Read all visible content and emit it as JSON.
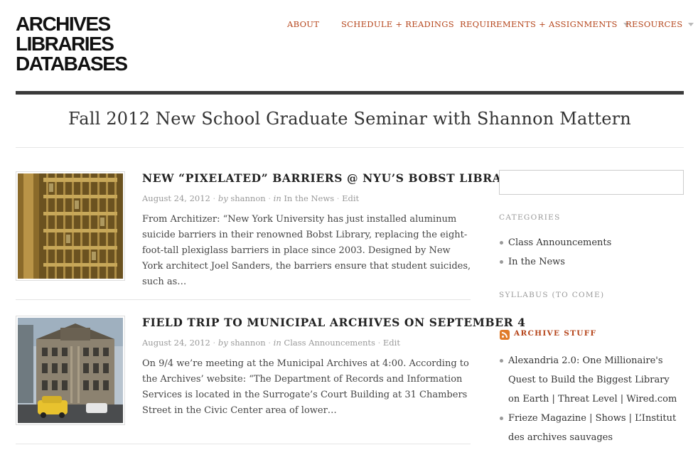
{
  "site": {
    "logo_lines": [
      "ARCHIVES",
      "LIBRARIES",
      "DATABASES"
    ],
    "tagline": "Fall 2012 New School Graduate Seminar with Shannon Mattern"
  },
  "nav": {
    "items": [
      {
        "label": "ABOUT",
        "has_dropdown": false
      },
      {
        "label": "SCHEDULE + READINGS",
        "has_dropdown": false
      },
      {
        "label": "REQUIREMENTS + ASSIGNMENTS",
        "has_dropdown": true
      },
      {
        "label": "RESOURCES",
        "has_dropdown": true
      }
    ]
  },
  "posts": [
    {
      "title": "NEW “PIXELATED” BARRIERS @ NYU’S BOBST LIBRARY",
      "date": "August 24, 2012",
      "by": "by",
      "author": "shannon",
      "in": "in",
      "category": "In the News",
      "edit": "Edit",
      "excerpt": "From Architizer: “New York University has just installed aluminum suicide barriers in their renowned Bobst Library, replacing the eight-foot-tall plexiglass barriers in place since 2003. Designed by New York architect Joel Sanders, the barriers ensure that student suicides, such as…",
      "thumb_icon": "library-barrier-photo"
    },
    {
      "title": "FIELD TRIP TO MUNICIPAL ARCHIVES ON SEPTEMBER 4",
      "date": "August 24, 2012",
      "by": "by",
      "author": "shannon",
      "in": "in",
      "category": "Class Announcements",
      "edit": "Edit",
      "excerpt": "On 9/4 we’re meeting at the Municipal Archives at 4:00. According to the Archives’ website: “The Department of Records and Information Services is located in the Surrogate’s Court Building at 31 Chambers Street in the Civic Center area of lower…",
      "thumb_icon": "surrogates-court-building-photo"
    }
  ],
  "sidebar": {
    "search_placeholder": "",
    "categories_title": "CATEGORIES",
    "categories": [
      "Class Announcements",
      "In the News"
    ],
    "syllabus_title": "SYLLABUS (TO COME)",
    "archive_title": "ARCHIVE STUFF",
    "archive_items": [
      "Alexandria 2.0: One Millionaire's Quest to Build the Biggest Library on Earth | Threat Level | Wired.com",
      "Frieze Magazine | Shows | L’Institut des archives sauvages"
    ]
  },
  "colors": {
    "accent": "#b5451b",
    "rss": "#e07b2a",
    "rule_dark": "#3a3a3a",
    "meta": "#999999"
  }
}
